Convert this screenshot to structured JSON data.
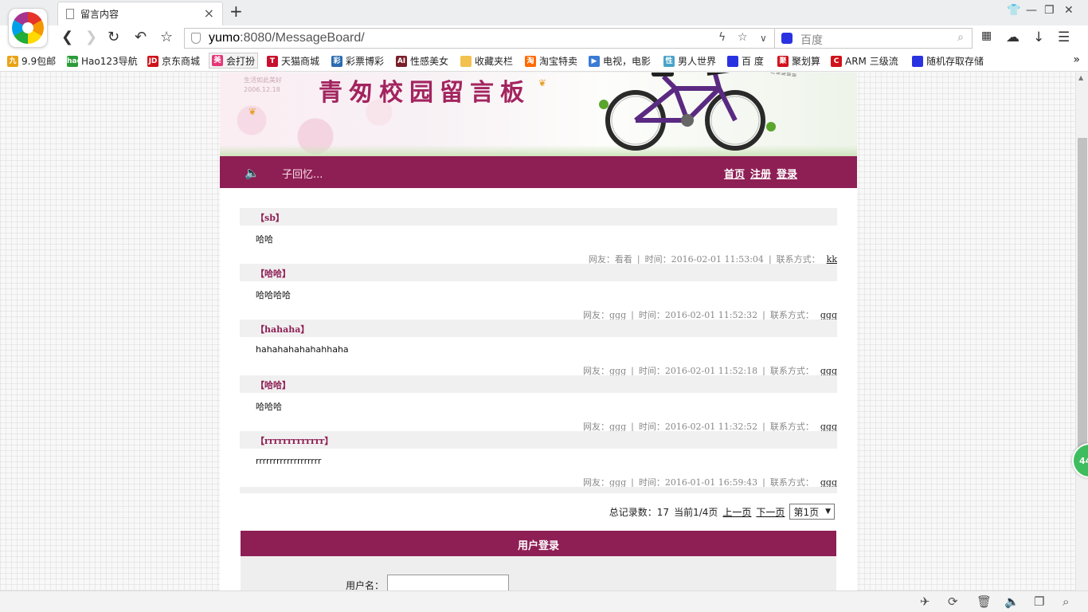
{
  "browser": {
    "tab_title": "留言内容",
    "url_host": "yumo",
    "url_rest": ":8080/MessageBoard/",
    "search_placeholder": "百度"
  },
  "bookmarks": [
    {
      "label": "9.9包邮",
      "icon_text": "九",
      "color": "#e8a317"
    },
    {
      "label": "Hao123导航",
      "icon_text": "hao",
      "color": "#2d9b3a"
    },
    {
      "label": "京东商城",
      "icon_text": "JD",
      "color": "#d0111b"
    },
    {
      "label": "会打扮",
      "icon_text": "美",
      "color": "#e4387a"
    },
    {
      "label": "天猫商城",
      "icon_text": "T",
      "color": "#c8102e"
    },
    {
      "label": "彩票博彩",
      "icon_text": "彩",
      "color": "#2b6cb0"
    },
    {
      "label": "性感美女",
      "icon_text": "AI",
      "color": "#7a1f2b"
    },
    {
      "label": "收藏夹栏",
      "icon_text": "",
      "color": "#f2c14e"
    },
    {
      "label": "淘宝特卖",
      "icon_text": "淘",
      "color": "#ff6a00"
    },
    {
      "label": "电视，电影",
      "icon_text": "▶",
      "color": "#3a7bd5"
    },
    {
      "label": "男人世界",
      "icon_text": "性",
      "color": "#4aa3c8"
    },
    {
      "label": "百 度",
      "icon_text": "",
      "color": "#2932e1"
    },
    {
      "label": "聚划算",
      "icon_text": "聚",
      "color": "#d0111b"
    },
    {
      "label": "ARM 三级流",
      "icon_text": "C",
      "color": "#d0111b"
    },
    {
      "label": "随机存取存储",
      "icon_text": "",
      "color": "#2932e1"
    }
  ],
  "site": {
    "banner_title": "青匆校园留言板",
    "banner_note_1": "生活如此美好",
    "banner_note_2": "2006.12.18",
    "marquee": "子回忆...",
    "nav": {
      "home": "首页",
      "register": "注册",
      "login": "登录"
    }
  },
  "meta_labels": {
    "user": "网友：",
    "time": "时间：",
    "contact": "联系方式："
  },
  "messages": [
    {
      "title": "【sb】",
      "body": "哈哈",
      "user": "看看",
      "time": "2016-02-01 11:53:04",
      "contact": "kk"
    },
    {
      "title": "【哈哈】",
      "body": "哈哈哈哈",
      "user": "ggg",
      "time": "2016-02-01 11:52:32",
      "contact": "ggg"
    },
    {
      "title": "【hahaha】",
      "body": "hahahahahahahhaha",
      "user": "ggg",
      "time": "2016-02-01 11:52:18",
      "contact": "ggg"
    },
    {
      "title": "【哈哈】",
      "body": "哈哈哈",
      "user": "ggg",
      "time": "2016-02-01 11:32:52",
      "contact": "ggg"
    },
    {
      "title": "【rrrrrrrrrrrrr】",
      "body": "rrrrrrrrrrrrrrrrrrr",
      "user": "ggg",
      "time": "2016-01-01 16:59:43",
      "contact": "ggg"
    }
  ],
  "pager": {
    "total_label": "总记录数：17",
    "current_label": "当前1/4页",
    "prev": "上一页",
    "next": "下一页",
    "selected_page": "第1页"
  },
  "login": {
    "header": "用户登录",
    "username_label": "用户名："
  },
  "floating_badge": "44",
  "colors": {
    "accent": "#8e1f54",
    "row_bg": "#f0f0f0"
  }
}
